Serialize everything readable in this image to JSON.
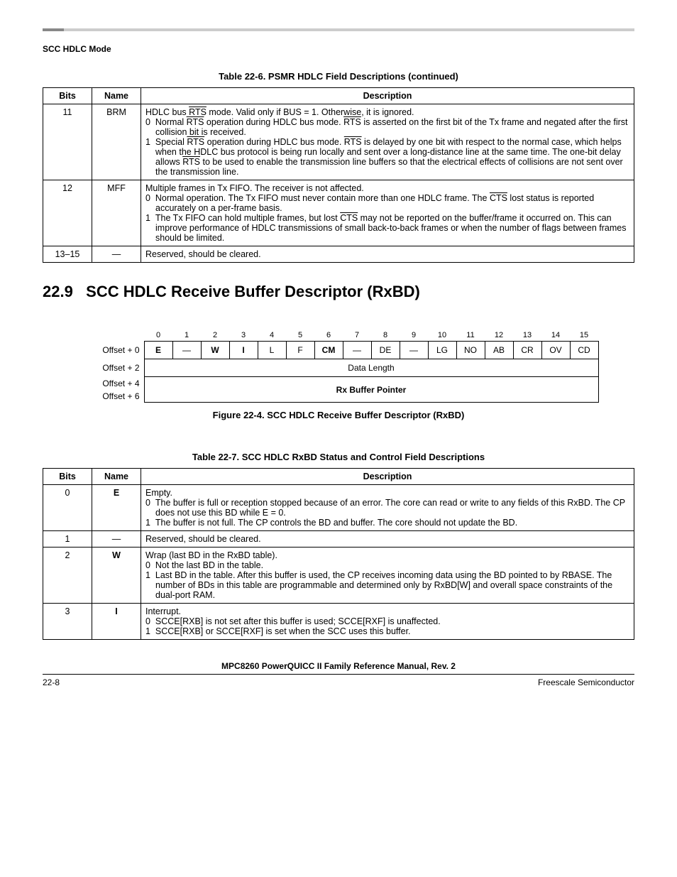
{
  "header": {
    "section_label": "SCC HDLC Mode"
  },
  "table6": {
    "caption": "Table 22-6. PSMR HDLC Field Descriptions  (continued)",
    "headers": {
      "bits": "Bits",
      "name": "Name",
      "description": "Description"
    },
    "rows": [
      {
        "bits": "11",
        "name": "BRM",
        "desc_intro": "HDLC bus RTS mode. Valid only if BUS = 1. Otherwise, it is ignored.",
        "opt0_num": "0",
        "opt0_txt": "Normal RTS operation during HDLC bus mode. RTS is asserted on the first bit of the Tx frame and negated after the first collision bit is received.",
        "opt1_num": "1",
        "opt1_txt": "Special RTS operation during HDLC bus mode. RTS is delayed by one bit with respect to the normal case, which helps when the HDLC bus protocol is being run locally and sent over a long-distance line at the same time. The one-bit delay allows RTS to be used to enable the transmission line buffers so that the electrical effects of collisions are not sent over the transmission line."
      },
      {
        "bits": "12",
        "name": "MFF",
        "desc_intro": "Multiple frames in Tx FIFO. The receiver is not affected.",
        "opt0_num": "0",
        "opt0_txt": "Normal operation. The Tx FIFO must never contain more than one HDLC frame. The CTS lost status is reported accurately on a per-frame basis.",
        "opt1_num": "1",
        "opt1_txt": "The Tx FIFO can hold multiple frames, but lost CTS may not be reported on the buffer/frame it occurred on. This can improve performance of HDLC transmissions of small back-to-back frames or when the number of flags between frames should be limited."
      },
      {
        "bits": "13–15",
        "name": "—",
        "desc_intro": "Reserved, should be cleared."
      }
    ]
  },
  "section": {
    "number": "22.9",
    "title": "SCC HDLC Receive Buffer Descriptor (RxBD)"
  },
  "chart_data": {
    "type": "table",
    "title": "Figure 22-4. SCC HDLC Receive Buffer Descriptor (RxBD)",
    "bit_numbers": [
      "0",
      "1",
      "2",
      "3",
      "4",
      "5",
      "6",
      "7",
      "8",
      "9",
      "10",
      "11",
      "12",
      "13",
      "14",
      "15"
    ],
    "rows": [
      {
        "label": "Offset + 0",
        "cells": [
          {
            "text": "E",
            "bold": true
          },
          {
            "text": "—"
          },
          {
            "text": "W",
            "bold": true
          },
          {
            "text": "I",
            "bold": true
          },
          {
            "text": "L"
          },
          {
            "text": "F"
          },
          {
            "text": "CM",
            "bold": true
          },
          {
            "text": "—"
          },
          {
            "text": "DE"
          },
          {
            "text": "—"
          },
          {
            "text": "LG"
          },
          {
            "text": "NO"
          },
          {
            "text": "AB"
          },
          {
            "text": "CR"
          },
          {
            "text": "OV"
          },
          {
            "text": "CD"
          }
        ]
      },
      {
        "label": "Offset + 2",
        "full_row": "Data Length",
        "bold": false
      },
      {
        "label": "Offset + 4",
        "full_row": "Rx Buffer Pointer",
        "bold": true,
        "rowspan": 2
      },
      {
        "label": "Offset + 6",
        "continuation": true
      }
    ]
  },
  "table7": {
    "caption": "Table 22-7. SCC HDLC RxBD Status and Control Field Descriptions",
    "headers": {
      "bits": "Bits",
      "name": "Name",
      "description": "Description"
    },
    "rows": [
      {
        "bits": "0",
        "name": "E",
        "name_bold": true,
        "desc_intro": "Empty.",
        "opt0_num": "0",
        "opt0_txt": "The buffer is full or reception stopped because of an error. The core can read or write to any fields of this RxBD. The CP does not use this BD while E = 0.",
        "opt1_num": "1",
        "opt1_txt": "The buffer is not full. The CP controls the BD and buffer. The core should not update the BD."
      },
      {
        "bits": "1",
        "name": "—",
        "desc_intro": "Reserved, should be cleared."
      },
      {
        "bits": "2",
        "name": "W",
        "name_bold": true,
        "desc_intro": "Wrap (last BD in the RxBD table).",
        "opt0_num": "0",
        "opt0_txt": "Not the last BD in the table.",
        "opt1_num": "1",
        "opt1_txt": "Last BD in the table. After this buffer is used, the CP receives incoming data using the BD pointed to by RBASE. The number of BDs in this table are programmable and determined only by RxBD[W] and overall space constraints of the dual-port RAM."
      },
      {
        "bits": "3",
        "name": "I",
        "name_bold": true,
        "desc_intro": "Interrupt.",
        "opt0_num": "0",
        "opt0_txt": "SCCE[RXB] is not set after this buffer is used; SCCE[RXF] is unaffected.",
        "opt1_num": "1",
        "opt1_txt": "SCCE[RXB] or SCCE[RXF] is set when the SCC uses this buffer."
      }
    ]
  },
  "footer": {
    "manual": "MPC8260 PowerQUICC II Family Reference Manual, Rev. 2",
    "page": "22-8",
    "company": "Freescale Semiconductor"
  }
}
